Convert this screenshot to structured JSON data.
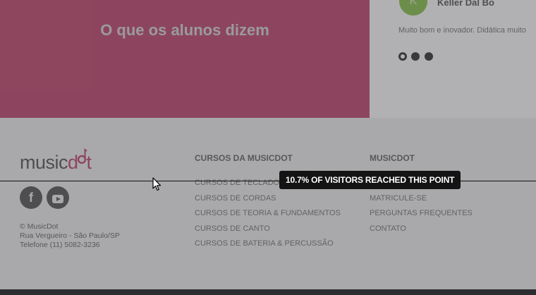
{
  "hero": {
    "title": "O que os alunos dizem"
  },
  "testimonial": {
    "avatar_letter": "K",
    "name": "Keller Dal Bo",
    "text": "Muito bom e inovador. Didática muito",
    "dots": [
      true,
      false,
      false
    ]
  },
  "footer": {
    "logo": {
      "part1": "music",
      "part2": "d",
      "part3": "t"
    },
    "social": [
      "facebook-icon",
      "youtube-icon"
    ],
    "facebook_glyph": "f",
    "address": [
      "© MusicDot",
      "Rua Vergueiro - São Paulo/SP",
      "Telefone (11) 5082-3236"
    ],
    "columns": [
      {
        "title": "CURSOS DA MUSICDOT",
        "links": [
          "CURSOS DE TECLADO",
          "CURSOS DE CORDAS",
          "CURSOS DE TEORIA & FUNDAMENTOS",
          "CURSOS DE CANTO",
          "CURSOS DE BATERIA & PERCUSSÃO"
        ]
      },
      {
        "title": "MUSICDOT",
        "links": [
          "",
          "MATRICULE-SE",
          "PERGUNTAS FREQUENTES",
          "CONTATO"
        ]
      }
    ]
  },
  "heatmap": {
    "tooltip": "10.7% OF VISITORS REACHED THIS POINT",
    "reached_percent": 10.7
  },
  "colors": {
    "accent": "#c2466e",
    "overlay": "#46464a",
    "tooltip_bg": "#141414"
  }
}
